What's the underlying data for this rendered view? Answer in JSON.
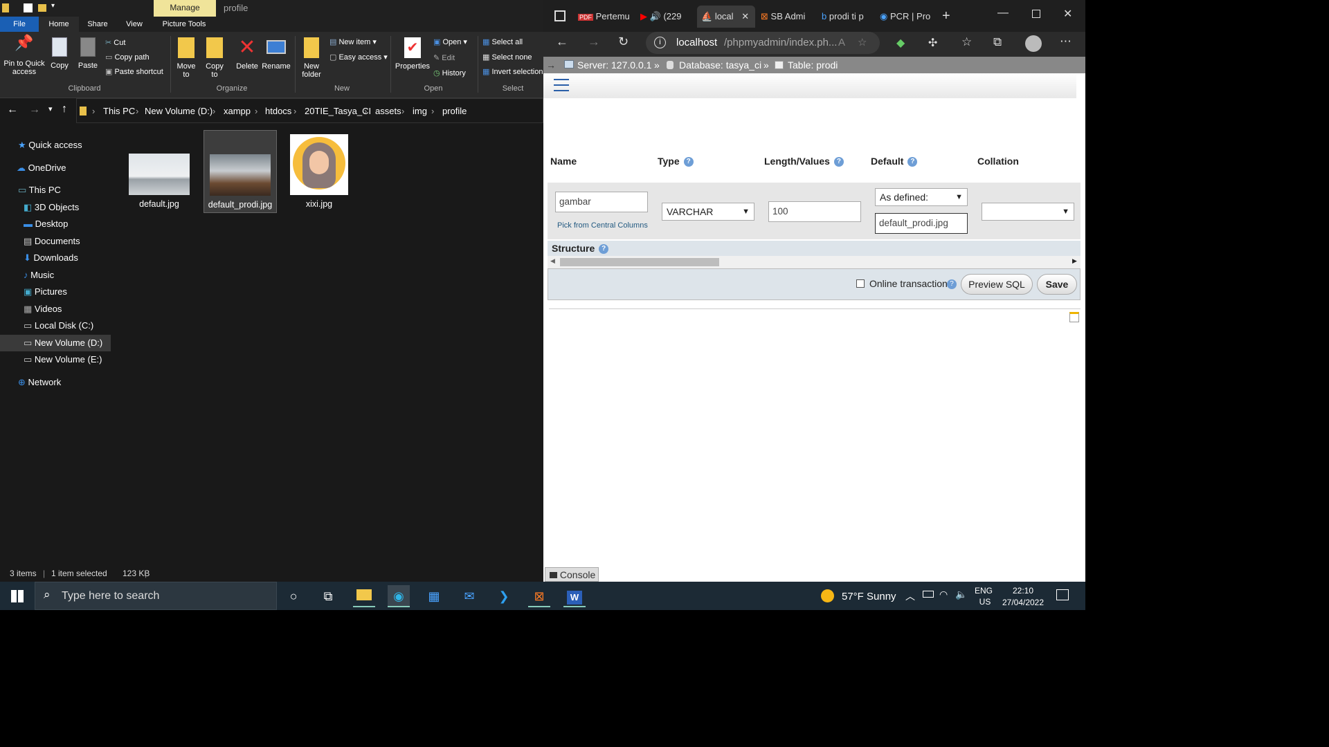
{
  "explorer": {
    "title_tab_manage": "Manage",
    "title_folder": "profile",
    "ribbon_tabs": [
      "File",
      "Home",
      "Share",
      "View",
      "Picture Tools"
    ],
    "clipboard": {
      "pin": "Pin to Quick access",
      "copy": "Copy",
      "paste": "Paste",
      "cut": "Cut",
      "copy_path": "Copy path",
      "paste_shortcut": "Paste shortcut",
      "label": "Clipboard"
    },
    "organize": {
      "move": "Move to",
      "copy_to": "Copy to",
      "delete": "Delete",
      "rename": "Rename",
      "label": "Organize"
    },
    "new_group": {
      "new_folder": "New folder",
      "new_item": "New item",
      "easy_access": "Easy access",
      "label": "New"
    },
    "open_group": {
      "properties": "Properties",
      "open": "Open",
      "edit": "Edit",
      "history": "History",
      "label": "Open"
    },
    "select_group": {
      "select_all": "Select all",
      "select_none": "Select none",
      "invert": "Invert selection",
      "label": "Select"
    },
    "breadcrumb": [
      "This PC",
      "New Volume (D:)",
      "xampp",
      "htdocs",
      "20TIE_Tasya_CI",
      "assets",
      "img",
      "profile"
    ],
    "nav": [
      "Quick access",
      "OneDrive",
      "This PC",
      "3D Objects",
      "Desktop",
      "Documents",
      "Downloads",
      "Music",
      "Pictures",
      "Videos",
      "Local Disk (C:)",
      "New Volume (D:)",
      "New Volume (E:)",
      "Network"
    ],
    "files": [
      {
        "name": "default.jpg"
      },
      {
        "name": "default_prodi.jpg"
      },
      {
        "name": "xixi.jpg"
      }
    ],
    "status": {
      "items": "3 items",
      "selected": "1 item selected",
      "size": "123 KB"
    }
  },
  "edge": {
    "tabs": [
      {
        "label": "Pertemu"
      },
      {
        "label": "(229"
      },
      {
        "label": "local"
      },
      {
        "label": "SB Admi"
      },
      {
        "label": "prodi ti p"
      },
      {
        "label": "PCR | Pro"
      }
    ],
    "url": "localhost/phpmyadmin/index.ph...",
    "url_host": "localhost",
    "url_path": "/phpmyadmin/index.ph..."
  },
  "pma": {
    "server": "Server: 127.0.0.1",
    "database": "Database: tasya_ci",
    "table": "Table: prodi",
    "col_name": "Name",
    "col_type": "Type",
    "col_length": "Length/Values",
    "col_default": "Default",
    "col_collation": "Collation",
    "field_name": "gambar",
    "pick_central": "Pick from Central Columns",
    "type_value": "VARCHAR",
    "length_value": "100",
    "default_select": "As defined:",
    "default_value": "default_prodi.jpg",
    "structure": "Structure",
    "online_transaction": "Online transaction",
    "preview_sql": "Preview SQL",
    "save": "Save",
    "console": "Console"
  },
  "taskbar": {
    "search_placeholder": "Type here to search",
    "weather": "57°F  Sunny",
    "lang1": "ENG",
    "lang2": "US",
    "time": "22:10",
    "date": "27/04/2022"
  }
}
